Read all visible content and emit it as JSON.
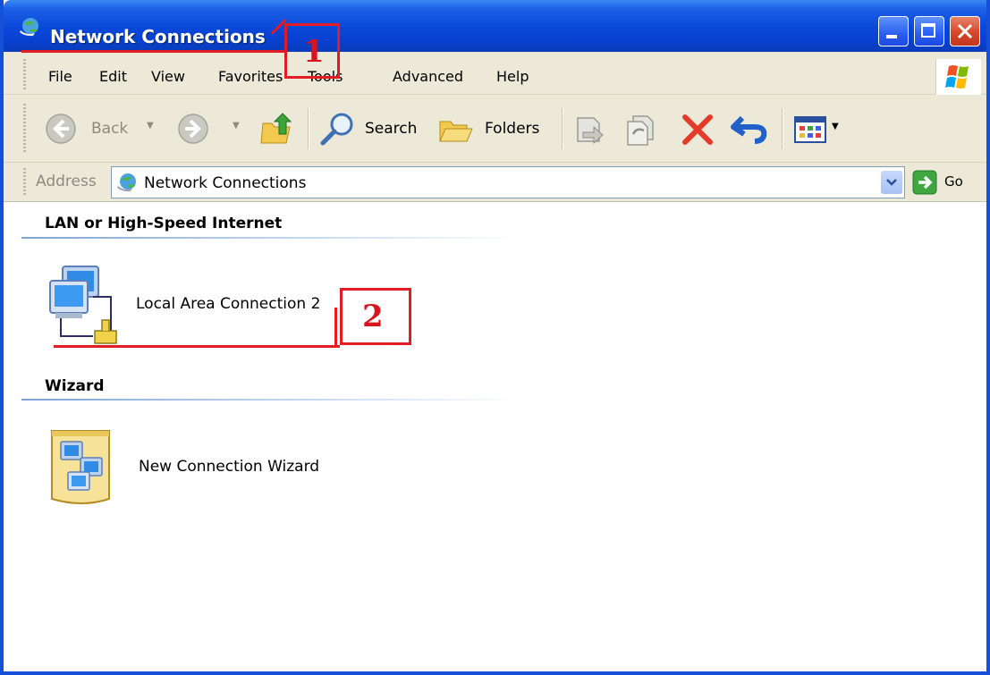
{
  "window": {
    "title": "Network Connections",
    "icon": "network-connections-icon",
    "controls": [
      "minimize-icon",
      "maximize-icon",
      "close-icon"
    ]
  },
  "menubar": {
    "items": [
      "File",
      "Edit",
      "View",
      "Favorites",
      "Tools",
      "Advanced",
      "Help"
    ]
  },
  "toolbar": {
    "back_label": "Back",
    "search_label": "Search",
    "folders_label": "Folders",
    "icons": [
      "back-icon",
      "forward-icon",
      "up-folder-icon",
      "search-icon",
      "folders-icon",
      "move-to-icon",
      "copy-to-icon",
      "delete-icon",
      "undo-icon",
      "views-icon"
    ]
  },
  "address": {
    "label": "Address",
    "value": "Network Connections",
    "go_label": "Go"
  },
  "content": {
    "groups": [
      {
        "title": "LAN or High-Speed Internet",
        "items": [
          {
            "label": "Local Area Connection 2",
            "icon": "lan-connection-icon"
          }
        ]
      },
      {
        "title": "Wizard",
        "items": [
          {
            "label": "New Connection Wizard",
            "icon": "connection-wizard-icon"
          }
        ]
      }
    ]
  },
  "annotations": [
    "1",
    "2"
  ],
  "colors": {
    "titlebar": "#0a47d9",
    "annotation": "#e31b23",
    "chrome": "#ece9d8"
  }
}
